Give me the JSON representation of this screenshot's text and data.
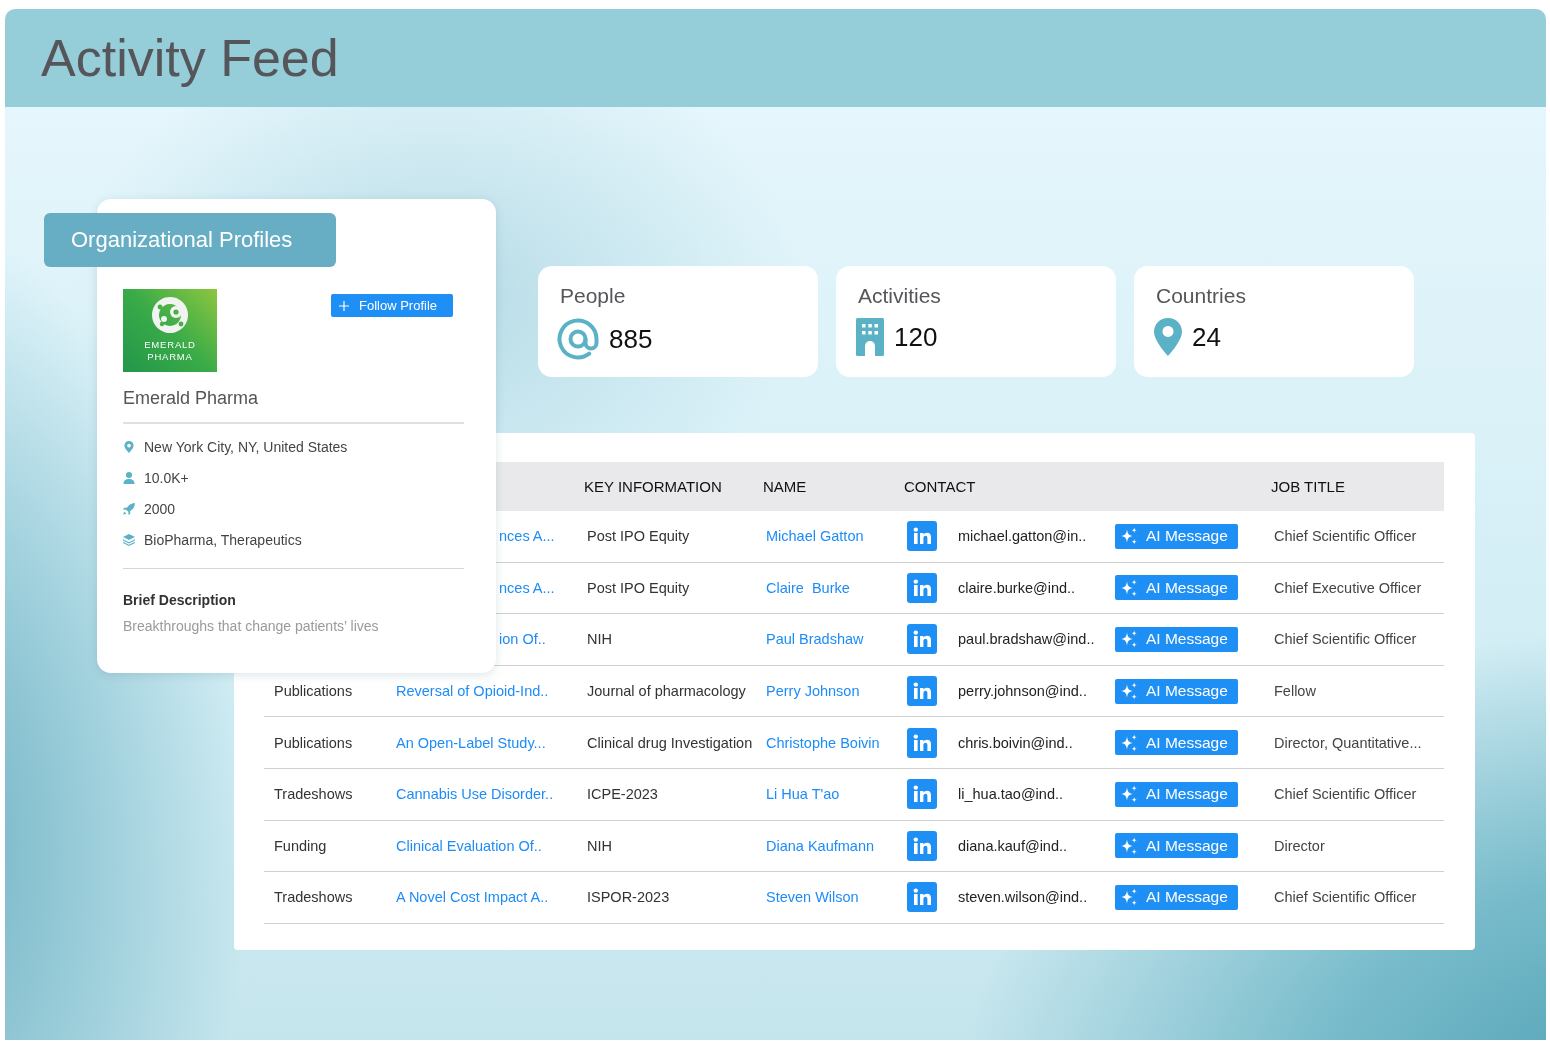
{
  "header": {
    "title": "Activity Feed"
  },
  "profile": {
    "section_tab": "Organizational Profiles",
    "logo_text": "EMERALD PHARMA",
    "follow_button": "Follow Profile",
    "name": "Emerald Pharma",
    "details": [
      {
        "kind": "location",
        "text": "New York City, NY, United States"
      },
      {
        "kind": "employees",
        "text": "10.0K+"
      },
      {
        "kind": "founded",
        "text": "2000"
      },
      {
        "kind": "industry",
        "text": "BioPharma, Therapeutics"
      }
    ],
    "description": {
      "heading": "Brief Description",
      "text": "Breakthroughs that change patients’ lives"
    }
  },
  "stats": [
    {
      "kind": "people",
      "label": "People",
      "value": "885"
    },
    {
      "kind": "activities",
      "label": "Activities",
      "value": "120"
    },
    {
      "kind": "countries",
      "label": "Countries",
      "value": "24"
    }
  ],
  "table": {
    "columns": [
      "KEY INFORMATION",
      "NAME",
      "CONTACT",
      "JOB TITLE"
    ],
    "rows": [
      {
        "title": "nces A...",
        "key_information": "Post IPO Equity",
        "name": "Michael Gatton",
        "email": "michael.gatton@in..",
        "action": "AI Message",
        "job_title": "Chief Scientific Officer"
      },
      {
        "title": "nces A...",
        "key_information": "Post IPO Equity",
        "name": "Claire  Burke",
        "email": "claire.burke@ind..",
        "action": "AI Message",
        "job_title": "Chief Executive Officer"
      },
      {
        "title": "ion Of..",
        "key_information": "NIH",
        "name": "Paul Bradshaw",
        "email": "paul.bradshaw@ind..",
        "action": "AI Message",
        "job_title": "Chief Scientific Officer"
      },
      {
        "type": "Publications",
        "title": "Reversal of Opioid-Ind..",
        "key_information": "Journal of pharmacology",
        "name": "Perry Johnson",
        "email": "perry.johnson@ind..",
        "action": "AI Message",
        "job_title": "Fellow"
      },
      {
        "type": "Publications",
        "title": "An Open-Label Study...",
        "key_information": "Clinical drug Investigation",
        "name": "Christophe Boivin",
        "email": "chris.boivin@ind..",
        "action": "AI Message",
        "job_title": "Director, Quantitative..."
      },
      {
        "type": "Tradeshows",
        "title": "Cannabis Use Disorder..",
        "key_information": "ICPE-2023",
        "name": "Li Hua T'ao",
        "email": "li_hua.tao@ind..",
        "action": "AI Message",
        "job_title": "Chief Scientific Officer"
      },
      {
        "type": "Funding",
        "title": "Clinical Evaluation Of..",
        "key_information": "NIH",
        "name": "Diana Kaufmann",
        "email": "diana.kauf@ind..",
        "action": "AI Message",
        "job_title": "Director"
      },
      {
        "type": "Tradeshows",
        "title": "A Novel Cost Impact A..",
        "key_information": "ISPOR-2023",
        "name": "Steven Wilson",
        "email": "steven.wilson@ind..",
        "action": "AI Message",
        "job_title": "Chief Scientific Officer"
      }
    ]
  }
}
